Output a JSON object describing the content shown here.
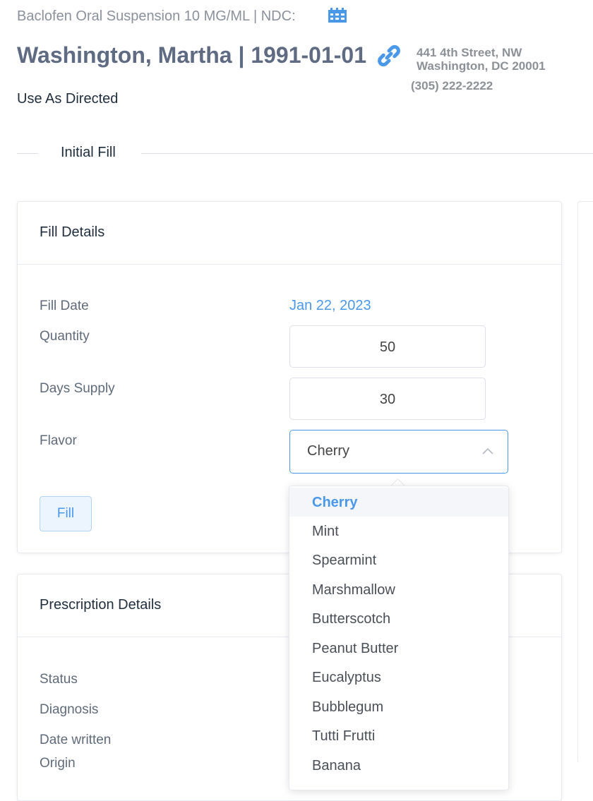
{
  "header": {
    "drug_line": "Baclofen Oral Suspension 10 MG/ML | NDC:",
    "ndc_icon": "barcode-icon",
    "patient_line": "Washington, Martha | 1991-01-01",
    "link_icon": "link-icon",
    "address_line1": "441 4th Street, NW",
    "address_line2": "Washington, DC 20001",
    "phone": "(305) 222-2222",
    "directions": "Use As Directed"
  },
  "divider": {
    "label": "Initial Fill"
  },
  "fill_details": {
    "title": "Fill Details",
    "fill_date_label": "Fill Date",
    "fill_date_value": "Jan 22, 2023",
    "quantity_label": "Quantity",
    "quantity_value": "50",
    "days_supply_label": "Days Supply",
    "days_supply_value": "30",
    "flavor_label": "Flavor",
    "flavor_value": "Cherry",
    "fill_button": "Fill"
  },
  "flavor_options": [
    "Cherry",
    "Mint",
    "Spearmint",
    "Marshmallow",
    "Butterscotch",
    "Peanut Butter",
    "Eucalyptus",
    "Bubblegum",
    "Tutti Frutti",
    "Banana"
  ],
  "selected_flavor_index": 0,
  "prescription_details": {
    "title": "Prescription Details",
    "status_label": "Status",
    "diagnosis_label": "Diagnosis",
    "date_written_label": "Date written",
    "origin_label": "Origin"
  },
  "colors": {
    "accent": "#4a98e8",
    "heading": "#5f6b82",
    "muted": "#8a919c",
    "border": "#e6e9ee"
  }
}
